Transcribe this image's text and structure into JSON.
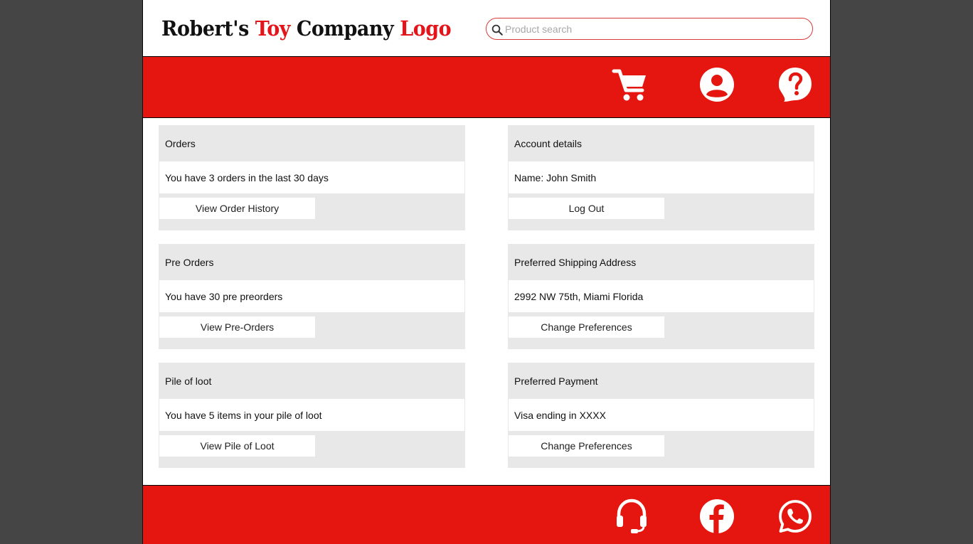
{
  "header": {
    "logo": {
      "part1": "Robert's ",
      "part2": "Toy",
      "part3": " Company ",
      "part4": "Logo"
    },
    "search": {
      "placeholder": "Product search",
      "icon": "search-icon"
    }
  },
  "navbar": {
    "icons": [
      "cart-icon",
      "account-icon",
      "help-icon"
    ]
  },
  "cards": {
    "orders": {
      "title": "Orders",
      "body": "You have 3 orders in the last 30 days",
      "button": "View Order History"
    },
    "account": {
      "title": "Account details",
      "body": "Name: John Smith",
      "button": "Log Out"
    },
    "preorders": {
      "title": "Pre Orders",
      "body": "You have 30 pre preorders",
      "button": "View Pre-Orders"
    },
    "shipping": {
      "title": "Preferred Shipping Address",
      "body": "2992 NW 75th, Miami Florida",
      "button": "Change Preferences"
    },
    "loot": {
      "title": "Pile of loot",
      "body": "You have 5 items in your pile of loot",
      "button": "View Pile of Loot"
    },
    "payment": {
      "title": "Preferred Payment",
      "body": "Visa ending in XXXX",
      "button": "Change Preferences"
    }
  },
  "footer": {
    "icons": [
      "headset-icon",
      "facebook-icon",
      "whatsapp-icon"
    ]
  },
  "colors": {
    "brand_red": "#e51610",
    "page_background": "#454545",
    "card_background": "#e8e8e8"
  }
}
